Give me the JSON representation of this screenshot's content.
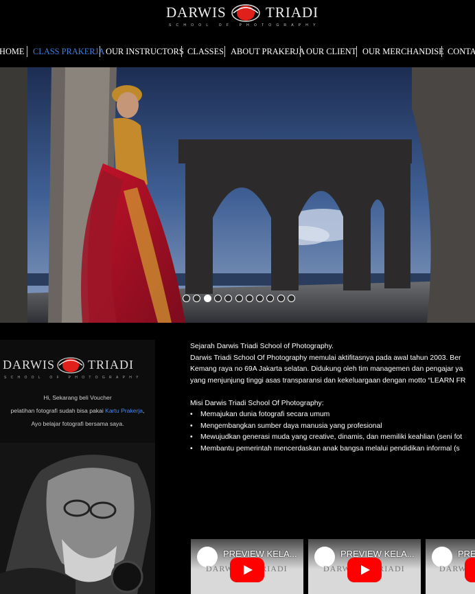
{
  "header": {
    "logo": {
      "left": "DARWIS",
      "right": "TRIADI",
      "tagline": "SCHOOL OF PHOTOGRAPHY"
    }
  },
  "nav": {
    "items": [
      {
        "label": "HOME"
      },
      {
        "label": "CLASS PRAKERJA",
        "active": true
      },
      {
        "label": "OUR INSTRUCTORS"
      },
      {
        "label": "CLASSES"
      },
      {
        "label": "ABOUT PRAKERJA"
      },
      {
        "label": "OUR CLIENT"
      },
      {
        "label": "OUR MERCHANDISE"
      },
      {
        "label": "CONTACT"
      }
    ]
  },
  "slider": {
    "total": 11,
    "current": 3
  },
  "promo": {
    "logo": {
      "left": "DARWIS",
      "right": "TRIADI",
      "tagline": "SCHOOL OF PHOTOGRAPHY"
    },
    "line1": "Hi, Sekarang beli Voucher",
    "line2_prefix": "pelatihan fotografi sudah bisa pakai ",
    "line2_link": "Kartu Prakerja",
    "line2_suffix": ",",
    "line3": "Ayo belajar fotografi bersama saya."
  },
  "about": {
    "history_title": "Sejarah Darwis Triadi School of Photography.",
    "history_lines": [
      "Darwis Triadi School Of Photography memulai aktifitasnya pada awal tahun 2003. Ber",
      "Kemang raya no 69A Jakarta selatan. Didukung oleh tim managemen dan pengajar ya",
      "yang menjunjung tinggi asas transparansi dan kekeluargaan dengan motto “LEARN FR"
    ],
    "mission_title": "Misi Darwis Triadi School Of Photography:",
    "mission_items": [
      "Memajukan dunia fotografi secara umum",
      "Mengembangkan sumber daya manusia yang profesional",
      "Mewujudkan generasi muda yang creative, dinamis, dan memiliki keahlian (seni fot",
      "Membantu pemerintah mencerdaskan anak bangsa melalui pendidikan informal (s"
    ]
  },
  "videos": [
    {
      "title": "PREVIEW KELA...",
      "logo_left": "DARWIS",
      "logo_right": "TRIADI"
    },
    {
      "title": "PREVIEW KELA...",
      "logo_left": "DARWIS",
      "logo_right": "TRIADI"
    },
    {
      "title": "PRE",
      "logo_left": "DARWI",
      "logo_right": ""
    }
  ],
  "colors": {
    "accent": "#3d7ddb",
    "logo_red": "#e0201b",
    "play": "#ff0000"
  }
}
